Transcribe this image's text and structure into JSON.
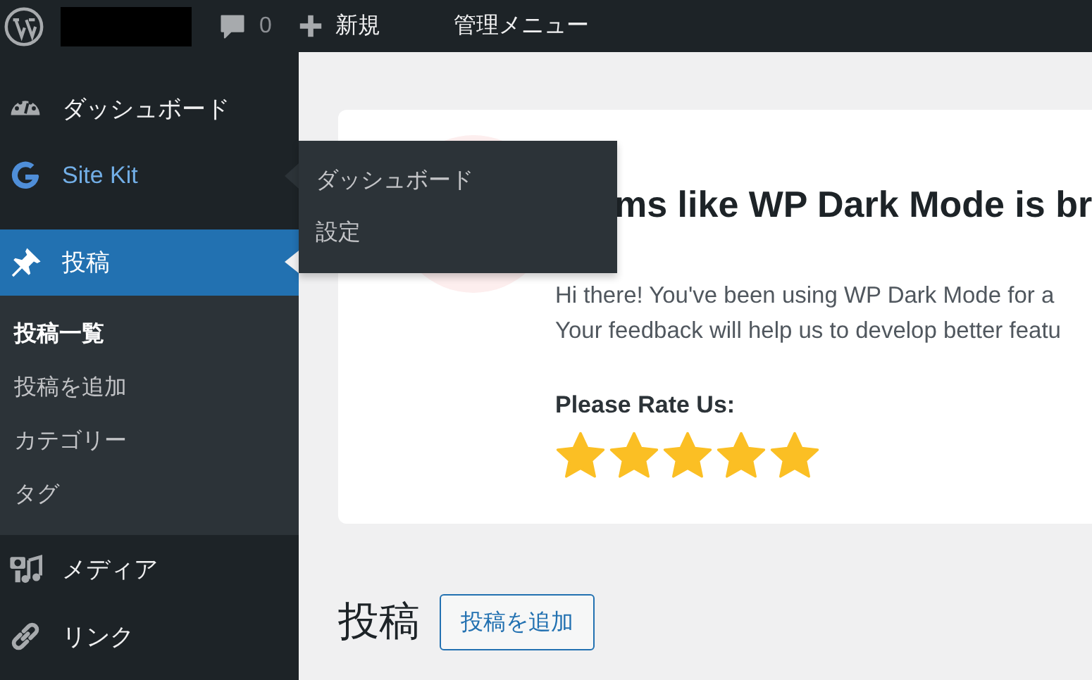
{
  "admin_bar": {
    "comment_count": "0",
    "new_label": "新規",
    "admin_menu_label": "管理メニュー"
  },
  "sidebar": {
    "items": [
      {
        "label": "ダッシュボード",
        "selected": false,
        "highlighted": false
      },
      {
        "label": "Site Kit",
        "selected": false,
        "highlighted": true
      },
      {
        "label": "投稿",
        "selected": true,
        "highlighted": false,
        "children": [
          {
            "label": "投稿一覧",
            "selected": true
          },
          {
            "label": "投稿を追加",
            "selected": false
          },
          {
            "label": "カテゴリー",
            "selected": false
          },
          {
            "label": "タグ",
            "selected": false
          }
        ]
      },
      {
        "label": "メディア",
        "selected": false,
        "highlighted": false
      },
      {
        "label": "リンク",
        "selected": false,
        "highlighted": false
      }
    ]
  },
  "flyout": {
    "items": [
      {
        "label": "ダッシュボード"
      },
      {
        "label": "設定"
      }
    ]
  },
  "notice": {
    "title": "ms like WP Dark Mode is br",
    "lines": [
      "Hi there! You've been using WP Dark Mode for a",
      "Your feedback will help us to develop better featu"
    ],
    "rating_label": "Please Rate Us:",
    "stars": 5
  },
  "page": {
    "title": "投稿",
    "add_button": "投稿を追加"
  }
}
